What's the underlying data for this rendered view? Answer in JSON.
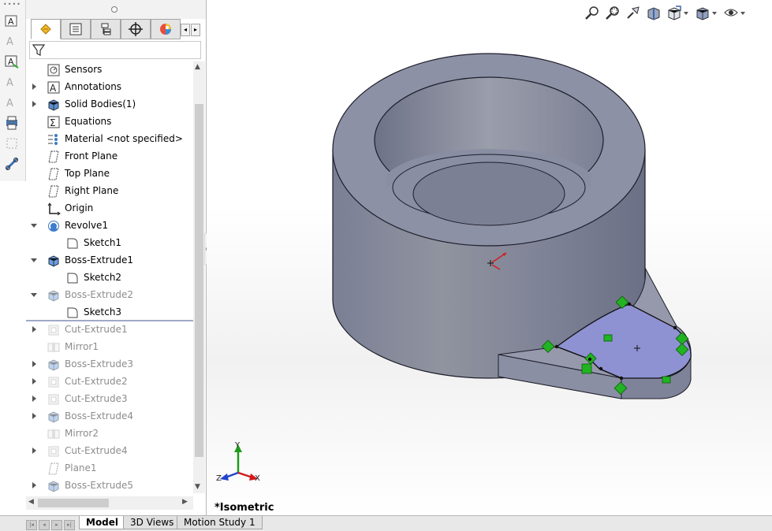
{
  "feature_tree": [
    {
      "label": "Sensors",
      "icon": "sensors-icon",
      "expandable": false,
      "level": 0,
      "dim": false
    },
    {
      "label": "Annotations",
      "icon": "annotations-icon",
      "expandable": true,
      "expanded": false,
      "level": 0,
      "dim": false
    },
    {
      "label": "Solid Bodies(1)",
      "icon": "solid-bodies-icon",
      "expandable": true,
      "expanded": false,
      "level": 0,
      "dim": false
    },
    {
      "label": "Equations",
      "icon": "equations-icon",
      "expandable": false,
      "level": 0,
      "dim": false
    },
    {
      "label": "Material <not specified>",
      "icon": "material-icon",
      "expandable": false,
      "level": 0,
      "dim": false
    },
    {
      "label": "Front Plane",
      "icon": "plane-icon",
      "expandable": false,
      "level": 0,
      "dim": false
    },
    {
      "label": "Top Plane",
      "icon": "plane-icon",
      "expandable": false,
      "level": 0,
      "dim": false
    },
    {
      "label": "Right Plane",
      "icon": "plane-icon",
      "expandable": false,
      "level": 0,
      "dim": false
    },
    {
      "label": "Origin",
      "icon": "origin-icon",
      "expandable": false,
      "level": 0,
      "dim": false
    },
    {
      "label": "Revolve1",
      "icon": "revolve-icon",
      "expandable": true,
      "expanded": true,
      "level": 0,
      "dim": false
    },
    {
      "label": "Sketch1",
      "icon": "sketch-icon",
      "expandable": false,
      "level": 1,
      "dim": false
    },
    {
      "label": "Boss-Extrude1",
      "icon": "boss-extrude-icon",
      "expandable": true,
      "expanded": true,
      "level": 0,
      "dim": false
    },
    {
      "label": "Sketch2",
      "icon": "sketch-icon",
      "expandable": false,
      "level": 1,
      "dim": false
    },
    {
      "label": "Boss-Extrude2",
      "icon": "boss-extrude-icon",
      "expandable": true,
      "expanded": true,
      "level": 0,
      "dim": true
    },
    {
      "label": "Sketch3",
      "icon": "sketch-icon",
      "expandable": false,
      "level": 1,
      "dim": false
    },
    {
      "label": "Cut-Extrude1",
      "icon": "cut-extrude-icon",
      "expandable": true,
      "expanded": false,
      "level": 0,
      "dim": true
    },
    {
      "label": "Mirror1",
      "icon": "mirror-icon",
      "expandable": false,
      "level": 0,
      "dim": true
    },
    {
      "label": "Boss-Extrude3",
      "icon": "boss-extrude-icon",
      "expandable": true,
      "expanded": false,
      "level": 0,
      "dim": true
    },
    {
      "label": "Cut-Extrude2",
      "icon": "cut-extrude-icon",
      "expandable": true,
      "expanded": false,
      "level": 0,
      "dim": true
    },
    {
      "label": "Cut-Extrude3",
      "icon": "cut-extrude-icon",
      "expandable": true,
      "expanded": false,
      "level": 0,
      "dim": true
    },
    {
      "label": "Boss-Extrude4",
      "icon": "boss-extrude-icon",
      "expandable": true,
      "expanded": false,
      "level": 0,
      "dim": true
    },
    {
      "label": "Mirror2",
      "icon": "mirror-icon",
      "expandable": false,
      "level": 0,
      "dim": true
    },
    {
      "label": "Cut-Extrude4",
      "icon": "cut-extrude-icon",
      "expandable": true,
      "expanded": false,
      "level": 0,
      "dim": true
    },
    {
      "label": "Plane1",
      "icon": "plane-icon",
      "expandable": false,
      "level": 0,
      "dim": true
    },
    {
      "label": "Boss-Extrude5",
      "icon": "boss-extrude-icon",
      "expandable": true,
      "expanded": false,
      "level": 0,
      "dim": true
    }
  ],
  "viewport": {
    "view_name": "*Isometric",
    "triad": {
      "x": "X",
      "y": "Y",
      "z": "Z"
    }
  },
  "bottom_tabs": [
    {
      "label": "Model",
      "active": true
    },
    {
      "label": "3D Views",
      "active": false
    },
    {
      "label": "Motion Study 1",
      "active": false
    }
  ],
  "colors": {
    "model_body": "#8b8fa4",
    "selected_face": "#8e92d2",
    "relation_green": "#22b322"
  }
}
